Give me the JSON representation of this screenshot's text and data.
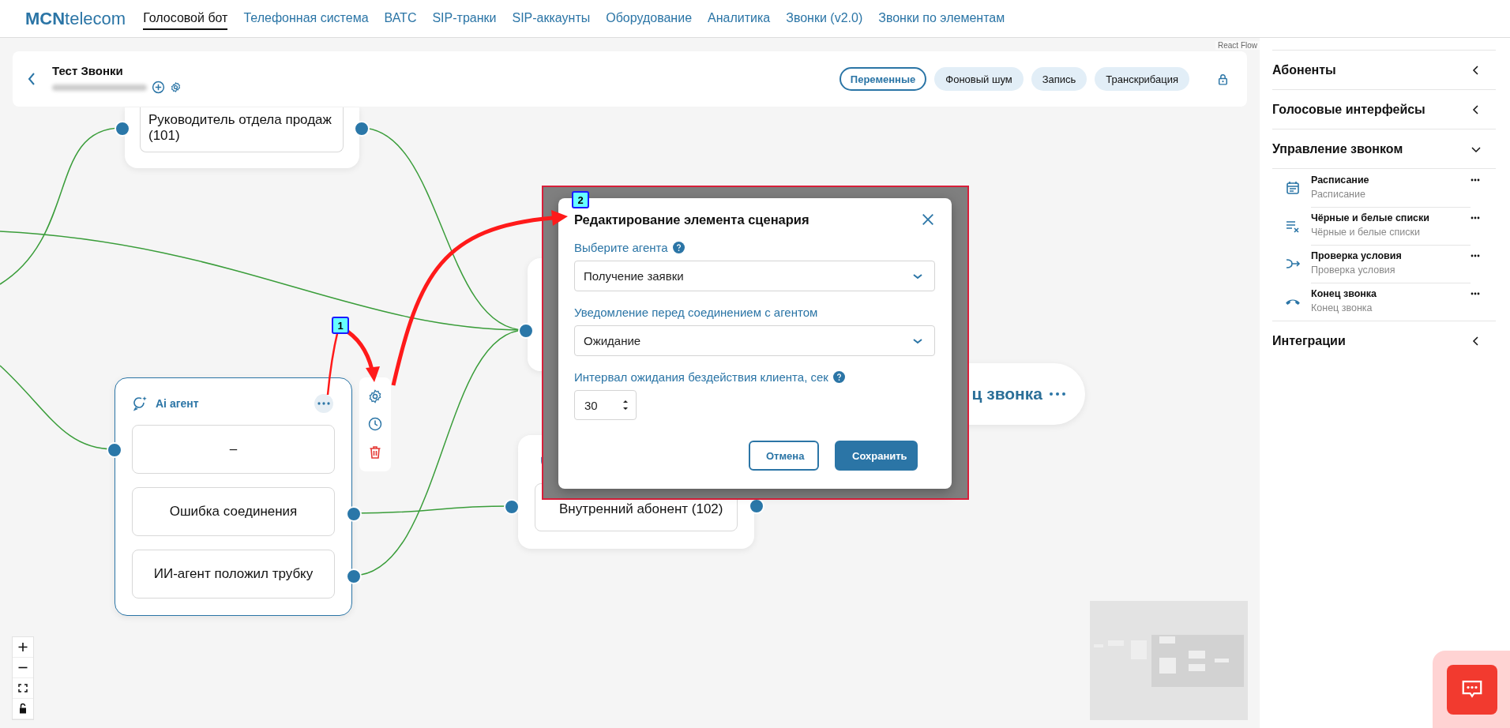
{
  "nav": {
    "logo": {
      "bold": "MCN",
      "rest": "telecom"
    },
    "items": [
      {
        "label": "Голосовой бот",
        "selected": true
      },
      {
        "label": "Телефонная система",
        "selected": false
      },
      {
        "label": "ВАТС",
        "selected": false
      },
      {
        "label": "SIP-транки",
        "selected": false
      },
      {
        "label": "SIP-аккаунты",
        "selected": false
      },
      {
        "label": "Оборудование",
        "selected": false
      },
      {
        "label": "Аналитика",
        "selected": false
      },
      {
        "label": "Звонки (v2.0)",
        "selected": false
      },
      {
        "label": "Звонки по элементам",
        "selected": false
      }
    ]
  },
  "canvas": {
    "attribution": "React Flow",
    "header": {
      "title": "Тест Звонки",
      "buttons": [
        {
          "label": "Переменные",
          "selected": true
        },
        {
          "label": "Фоновый шум",
          "selected": false
        },
        {
          "label": "Запись",
          "selected": false
        },
        {
          "label": "Транскрибация",
          "selected": false
        }
      ]
    },
    "manager_node": {
      "text": "Руководитель отдела продаж (101)"
    },
    "ai_agent_node": {
      "title": "Ai агент",
      "outputs": [
        "–",
        "Ошибка соединения",
        "ИИ-агент положил трубку"
      ]
    },
    "extension_node": {
      "text": "Внутренний абонент (102)"
    },
    "end_node": {
      "text": "ц звонка"
    }
  },
  "modal": {
    "title": "Редактирование элемента сценария",
    "fields": [
      {
        "kind": "select",
        "label": "Выберите агента",
        "help": true,
        "value": "Получение заявки"
      },
      {
        "kind": "select",
        "label": "Уведомление перед соединением с агентом",
        "help": false,
        "value": "Ожидание"
      },
      {
        "kind": "number",
        "label": "Интервал ожидания бездействия клиента, сек",
        "help": true,
        "value": "30"
      }
    ],
    "buttons": [
      {
        "kind": "secondary",
        "label": "Отмена"
      },
      {
        "kind": "primary",
        "label": "Сохранить"
      }
    ]
  },
  "callouts": [
    {
      "label": "1"
    },
    {
      "label": "2"
    }
  ],
  "sidebar": {
    "sections": [
      {
        "title": "Абоненты",
        "expanded": false
      },
      {
        "title": "Голосовые интерфейсы",
        "expanded": false
      },
      {
        "title": "Управление звонком",
        "expanded": true,
        "items": [
          {
            "kind": "schedule",
            "title": "Расписание",
            "subtitle": "Расписание"
          },
          {
            "kind": "lists",
            "title": "Чёрные и белые списки",
            "subtitle": "Чёрные и белые списки"
          },
          {
            "kind": "condition",
            "title": "Проверка условия",
            "subtitle": "Проверка условия"
          },
          {
            "kind": "hangup",
            "title": "Конец звонка",
            "subtitle": "Конец звонка"
          }
        ]
      },
      {
        "title": "Интеграции",
        "expanded": false
      }
    ]
  }
}
